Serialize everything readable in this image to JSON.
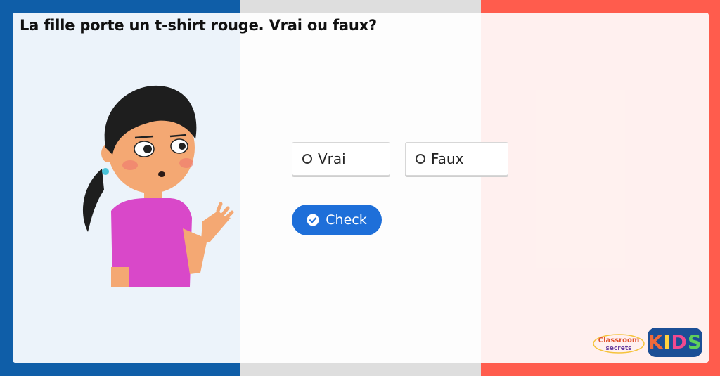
{
  "question": "La fille porte un t-shirt rouge. Vrai ou faux?",
  "options": [
    {
      "label": "Vrai",
      "selected": false
    },
    {
      "label": "Faux",
      "selected": false
    }
  ],
  "check_button": {
    "label": "Check",
    "icon": "check-circle-icon"
  },
  "branding": {
    "classroom_secrets": [
      "Classroom",
      "secrets"
    ],
    "kids_logo": [
      "K",
      "I",
      "D",
      "S"
    ]
  },
  "colors": {
    "flag_blue": "#0f5ea8",
    "flag_white": "#dedede",
    "flag_red": "#ff5c4d",
    "accent": "#1e6fd9",
    "tshirt": "#d948c9"
  }
}
